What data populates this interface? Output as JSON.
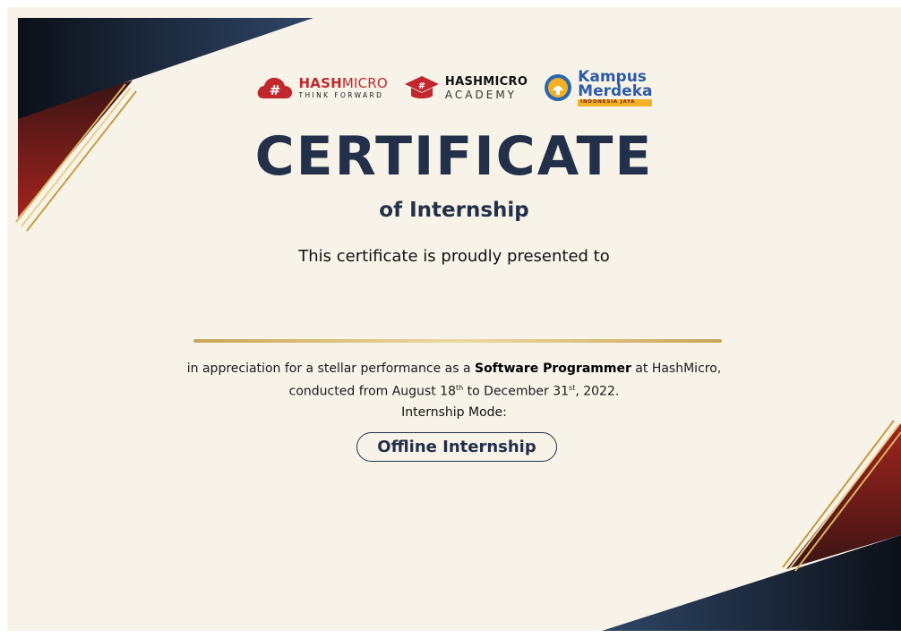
{
  "logos": {
    "hashmicro": {
      "name_bold": "HASH",
      "name_thin": "MICRO",
      "tagline": "THINK FORWARD"
    },
    "academy": {
      "name": "HASHMICRO",
      "tagline": "ACADEMY"
    },
    "kampus_merdeka": {
      "line1": "Kampus",
      "line2": "Merdeka",
      "ribbon": "INDONESIA JAYA"
    }
  },
  "title": "CERTIFICATE",
  "subtitle": "of Internship",
  "presented_text": "This certificate is proudly presented to",
  "appreciation": {
    "prefix": "in appreciation for a stellar performance as a ",
    "role": "Software Programmer",
    "suffix": " at HashMicro,",
    "line2_a": "conducted from August 18",
    "sup1": "th",
    "line2_b": " to December 31",
    "sup2": "st",
    "line2_c": ", 2022."
  },
  "mode_label": "Internship Mode:",
  "mode_value": "Offline Internship",
  "colors": {
    "navy": "#23304a",
    "red": "#c1272d",
    "gold": "#d4b46a",
    "background": "#f8f3e8"
  }
}
